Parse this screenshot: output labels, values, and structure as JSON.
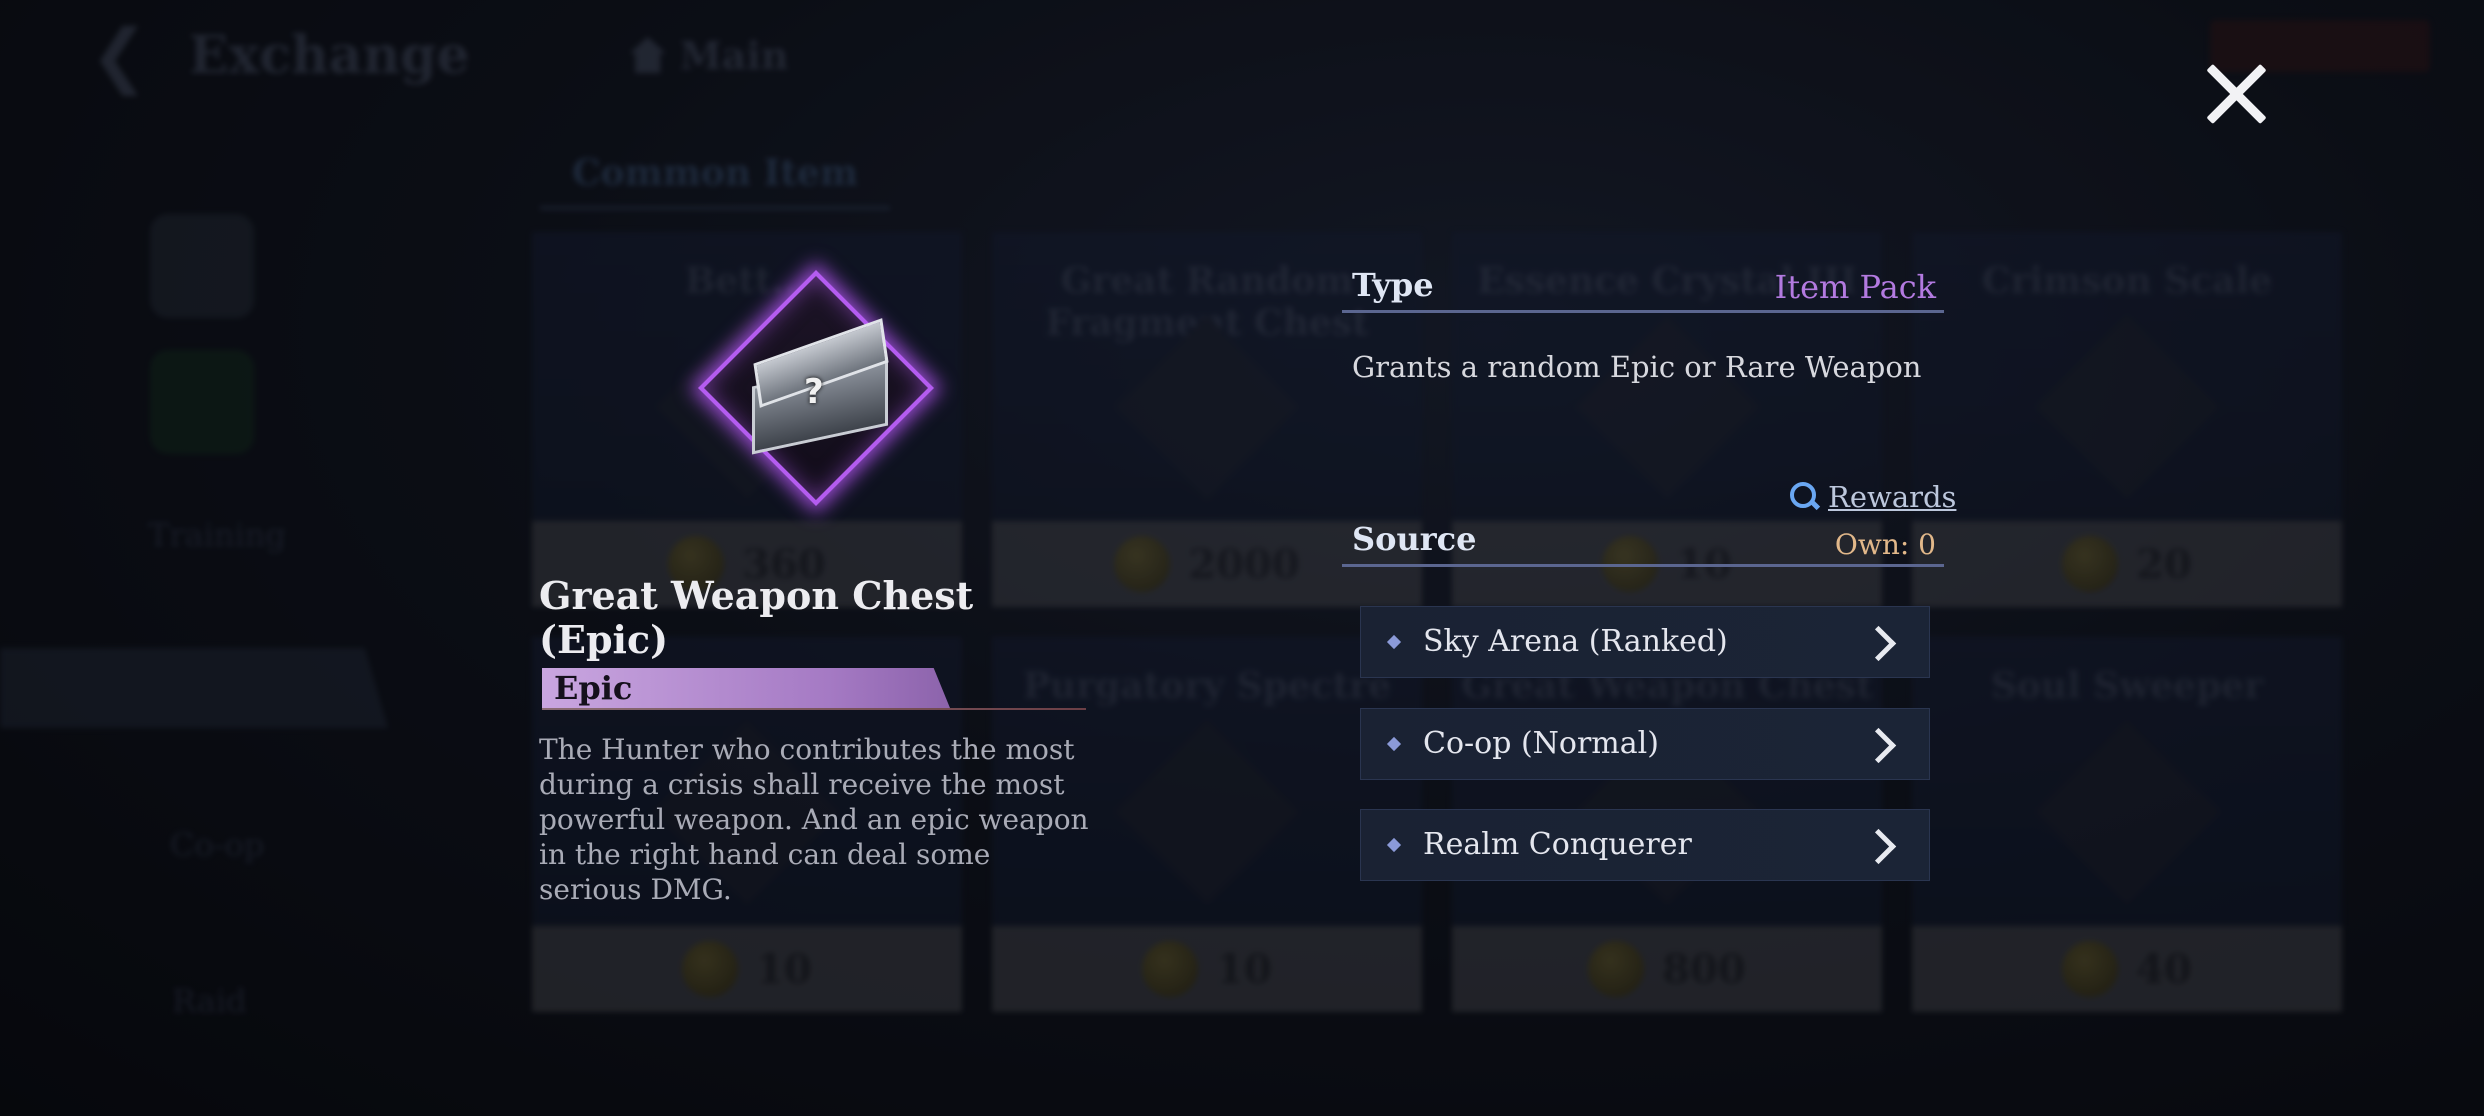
{
  "background": {
    "title": "Exchange",
    "home_label": "Main",
    "tab_label": "Common Item",
    "side_labels": [
      "Training",
      "Co-op",
      "Raid"
    ],
    "cards": [
      {
        "name": "Bett...",
        "price": "360"
      },
      {
        "name": "Great Random Fragment Chest",
        "price": "2000"
      },
      {
        "name": "Essence Crystal III",
        "price": "10"
      },
      {
        "name": "Crimson Scale",
        "price": "20"
      },
      {
        "name": "",
        "price": "10"
      },
      {
        "name": "Purgatory Spectre",
        "price": "10"
      },
      {
        "name": "Great Weapon Chest (Epic)",
        "price": "800"
      },
      {
        "name": "Soul Sweeper",
        "price": "40"
      }
    ]
  },
  "item": {
    "name": "Great Weapon Chest (Epic)",
    "rarity": "Epic",
    "description": "The Hunter who contributes the most during a crisis shall receive the most powerful weapon. And an epic weapon in the right hand can deal some serious DMG.",
    "icon": "weapon-chest-icon",
    "glow_color": "#b45cf0"
  },
  "info": {
    "type_label": "Type",
    "type_value": "Item Pack",
    "type_description": "Grants a random Epic or Rare Weapon",
    "rewards_label": "Rewards",
    "source_label": "Source",
    "own_label": "Own: 0",
    "sources": [
      {
        "label": "Sky Arena (Ranked)"
      },
      {
        "label": "Co-op (Normal)"
      },
      {
        "label": "Realm Conquerer"
      }
    ]
  },
  "colors": {
    "rarity_epic": "#b37ae0",
    "own_text": "#e2b88a",
    "rewards_icon": "#6aa7f2"
  }
}
